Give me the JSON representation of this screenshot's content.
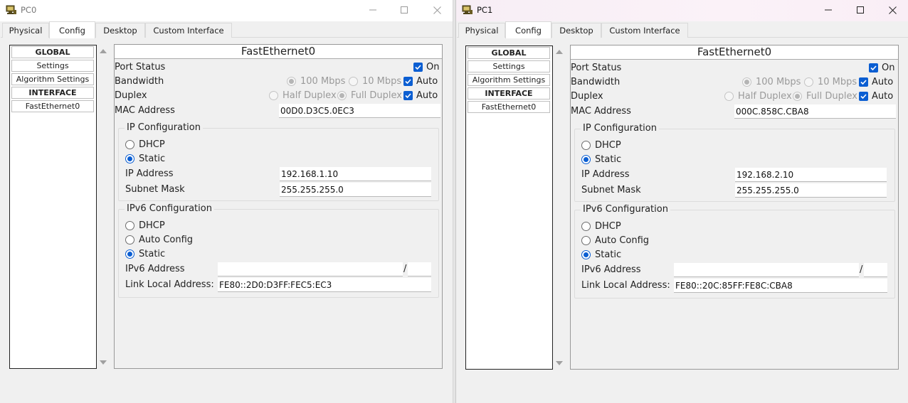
{
  "windows": [
    {
      "title": "PC0",
      "tabs": [
        "Physical",
        "Config",
        "Desktop",
        "Custom Interface"
      ],
      "active_tab": "Config",
      "sidebar": [
        "GLOBAL",
        "Settings",
        "Algorithm Settings",
        "INTERFACE",
        "FastEthernet0"
      ],
      "panel_title": "FastEthernet0",
      "port_status_label": "Port Status",
      "port_status_on": "On",
      "bandwidth_label": "Bandwidth",
      "bw_100": "100 Mbps",
      "bw_10": "10 Mbps",
      "bw_auto": "Auto",
      "duplex_label": "Duplex",
      "half_duplex": "Half Duplex",
      "full_duplex": "Full Duplex",
      "duplex_auto": "Auto",
      "mac_label": "MAC Address",
      "mac_value": "00D0.D3C5.0EC3",
      "ip_config_title": "IP Configuration",
      "dhcp_label": "DHCP",
      "static_label": "Static",
      "ip_label": "IP Address",
      "ip_value": "192.168.1.10",
      "mask_label": "Subnet Mask",
      "mask_value": "255.255.255.0",
      "ipv6_config_title": "IPv6 Configuration",
      "ipv6_dhcp": "DHCP",
      "ipv6_auto": "Auto Config",
      "ipv6_static": "Static",
      "ipv6_addr_label": "IPv6 Address",
      "ipv6_addr_value": "",
      "ipv6_slash": "/",
      "ipv6_prefix_value": "",
      "link_local_label": "Link Local Address:",
      "link_local_value": "FE80::2D0:D3FF:FEC5:EC3"
    },
    {
      "title": "PC1",
      "tabs": [
        "Physical",
        "Config",
        "Desktop",
        "Custom Interface"
      ],
      "active_tab": "Config",
      "sidebar": [
        "GLOBAL",
        "Settings",
        "Algorithm Settings",
        "INTERFACE",
        "FastEthernet0"
      ],
      "panel_title": "FastEthernet0",
      "port_status_label": "Port Status",
      "port_status_on": "On",
      "bandwidth_label": "Bandwidth",
      "bw_100": "100 Mbps",
      "bw_10": "10 Mbps",
      "bw_auto": "Auto",
      "duplex_label": "Duplex",
      "half_duplex": "Half Duplex",
      "full_duplex": "Full Duplex",
      "duplex_auto": "Auto",
      "mac_label": "MAC Address",
      "mac_value": "000C.858C.CBA8",
      "ip_config_title": "IP Configuration",
      "dhcp_label": "DHCP",
      "static_label": "Static",
      "ip_label": "IP Address",
      "ip_value": "192.168.2.10",
      "mask_label": "Subnet Mask",
      "mask_value": "255.255.255.0",
      "ipv6_config_title": "IPv6 Configuration",
      "ipv6_dhcp": "DHCP",
      "ipv6_auto": "Auto Config",
      "ipv6_static": "Static",
      "ipv6_addr_label": "IPv6 Address",
      "ipv6_addr_value": "",
      "ipv6_slash": "/",
      "ipv6_prefix_value": "",
      "link_local_label": "Link Local Address:",
      "link_local_value": "FE80::20C:85FF:FE8C:CBA8"
    }
  ],
  "colors": {
    "checkbox_accent": "#0b5ed2",
    "window_bg": "#f0f0f0"
  },
  "icons": [
    "packet-tracer-pc-icon",
    "minimize-icon",
    "maximize-icon",
    "close-icon"
  ]
}
